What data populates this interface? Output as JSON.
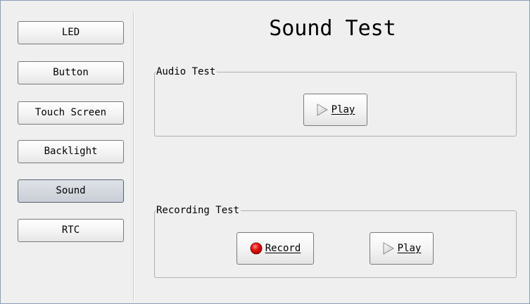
{
  "window": {
    "title": "Sound Test"
  },
  "sidebar": {
    "items": [
      {
        "label": "LED"
      },
      {
        "label": "Button"
      },
      {
        "label": "Touch Screen"
      },
      {
        "label": "Backlight"
      },
      {
        "label": "Sound",
        "selected": true
      },
      {
        "label": "RTC"
      }
    ]
  },
  "audio_test": {
    "label": "Audio Test",
    "play_label": "Play",
    "play_icon": "play-icon"
  },
  "recording_test": {
    "label": "Recording Test",
    "record_label": "Record",
    "record_icon": "record-icon",
    "play_label": "Play",
    "play_icon": "play-icon"
  },
  "colors": {
    "record": "#e00000",
    "selected_nav": "#cfd4db",
    "background": "#efefef"
  }
}
